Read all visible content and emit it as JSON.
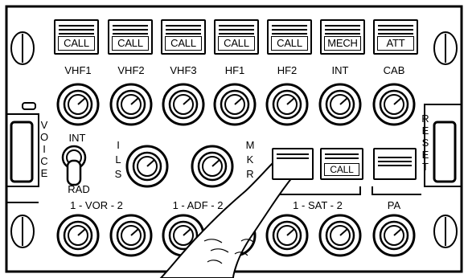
{
  "top_buttons": [
    {
      "label": "CALL"
    },
    {
      "label": "CALL"
    },
    {
      "label": "CALL"
    },
    {
      "label": "CALL"
    },
    {
      "label": "CALL"
    },
    {
      "label": "MECH"
    },
    {
      "label": "ATT"
    }
  ],
  "knob_labels_row1": [
    "VHF1",
    "VHF2",
    "VHF3",
    "HF1",
    "HF2",
    "INT",
    "CAB"
  ],
  "left_switch": {
    "vertical_label": "VOICE",
    "top_label": "INT",
    "bottom_label": "RAD"
  },
  "right_switch": {
    "vertical_label": "RESET"
  },
  "middle": {
    "ils_label": "ILS",
    "mkr_label": "MKR",
    "call_button": "CALL"
  },
  "knob_labels_row3": {
    "vor": "1 - VOR - 2",
    "adf": "1 - ADF - 2",
    "sat": "1 - SAT - 2",
    "pa": "PA"
  }
}
